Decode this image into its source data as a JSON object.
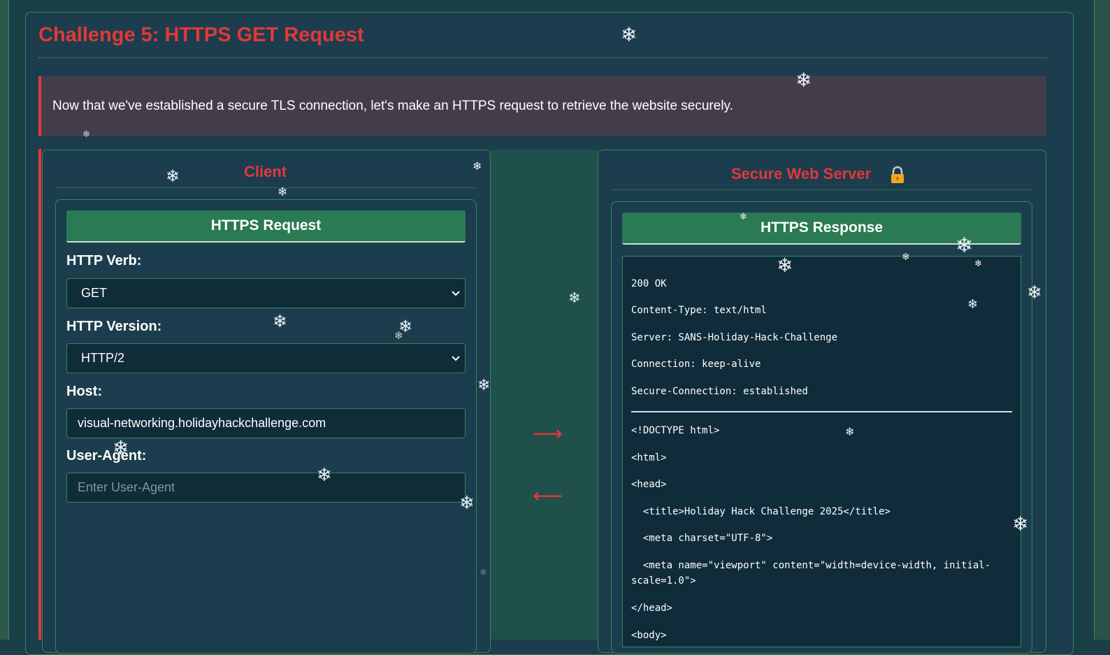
{
  "challenge": {
    "title": "Challenge 5: HTTPS GET Request",
    "intro": "Now that we've established a secure TLS connection, let's make an HTTPS request to retrieve the website securely."
  },
  "client": {
    "heading": "Client",
    "request_title": "HTTPS Request",
    "verb_label": "HTTP Verb:",
    "verb_value": "GET",
    "version_label": "HTTP Version:",
    "version_value": "HTTP/2",
    "host_label": "Host:",
    "host_value": "visual-networking.holidayhackchallenge.com",
    "user_agent_label": "User-Agent:",
    "user_agent_value": "",
    "user_agent_placeholder": "Enter User-Agent"
  },
  "channel": {
    "arrow_right": "⟶",
    "arrow_left": "⟵"
  },
  "server": {
    "heading": "Secure Web Server",
    "lock_icon": "lock-icon",
    "response_title": "HTTPS Response",
    "headers": [
      "200 OK",
      "Content-Type: text/html",
      "Server: SANS-Holiday-Hack-Challenge",
      "Connection: keep-alive",
      "Secure-Connection: established"
    ],
    "body": [
      "<!DOCTYPE html>",
      "<html>",
      "<head>",
      "  <title>Holiday Hack Challenge 2025</title>",
      "  <meta charset=\"UTF-8\">",
      "  <meta name=\"viewport\" content=\"width=device-width, initial-scale=1.0\">",
      "</head>",
      "<body>"
    ]
  },
  "colors": {
    "accent": "#e33838",
    "button": "#2a7a53",
    "panel": "#1c3d4d",
    "border": "#2f8b56"
  },
  "decor": {
    "snowflake_icon": "❄"
  }
}
